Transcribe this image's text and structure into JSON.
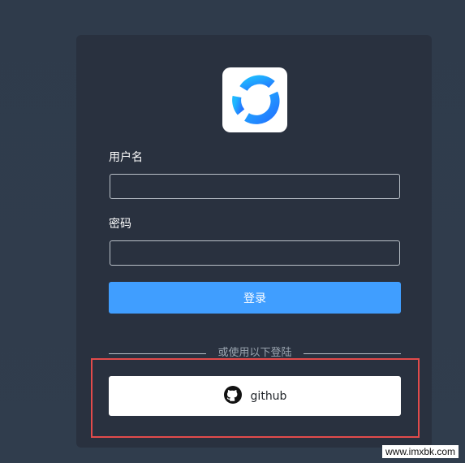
{
  "form": {
    "username_label": "用户名",
    "username_value": "",
    "password_label": "密码",
    "password_value": "",
    "login_button": "登录",
    "divider_text": "或使用以下登陆",
    "github_button": "github"
  },
  "watermark": "www.imxbk.com",
  "colors": {
    "page_background": "#303d4d",
    "card_background": "#29313f",
    "primary": "#409eff",
    "github_button": "#ffffff",
    "highlight": "#e24b4b"
  },
  "icons": {
    "logo": "circular-sync-logo-icon",
    "github": "github-icon"
  }
}
